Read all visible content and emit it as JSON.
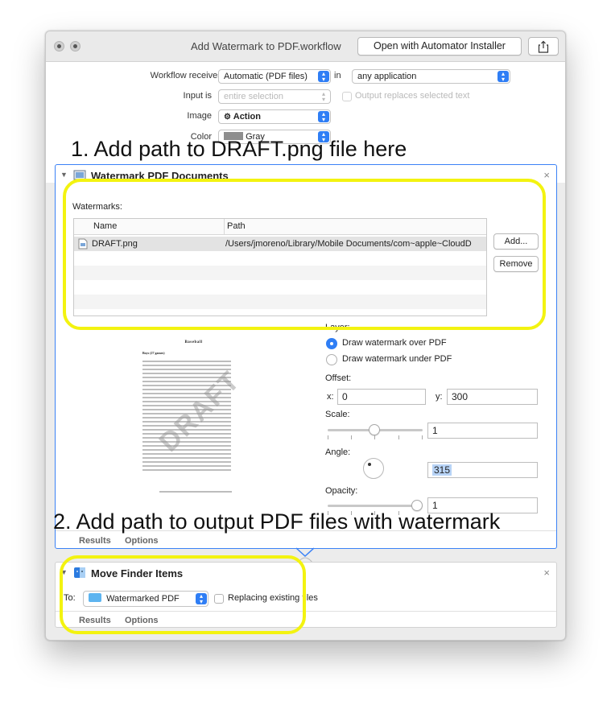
{
  "window": {
    "title": "Add Watermark to PDF.workflow",
    "open_button": "Open with Automator Installer",
    "share_icon": "share-icon"
  },
  "settings": {
    "receives_label": "Workflow receives current",
    "receives_value": "Automatic (PDF files)",
    "in_label": "in",
    "app_value": "any application",
    "input_is_label": "Input is",
    "input_is_value": "entire selection",
    "replaces_label": "Output replaces selected text",
    "image_label": "Image",
    "image_value": "Action",
    "color_label": "Color",
    "color_value": "Gray"
  },
  "annotations": {
    "step1": "1. Add path to DRAFT.png file here",
    "step2": "2. Add path to output PDF files with watermark"
  },
  "action1": {
    "title": "Watermark PDF Documents",
    "watermarks_label": "Watermarks:",
    "columns": [
      "Name",
      "Path"
    ],
    "rows": [
      {
        "name": "DRAFT.png",
        "path": "/Users/jmoreno/Library/Mobile Documents/com~apple~CloudD"
      }
    ],
    "add_button": "Add...",
    "remove_button": "Remove",
    "layer_label": "Layer:",
    "layer_over": "Draw watermark over PDF",
    "layer_under": "Draw watermark under PDF",
    "layer_selected": "over",
    "offset_label": "Offset:",
    "x_label": "x:",
    "x_value": "0",
    "y_label": "y:",
    "y_value": "300",
    "scale_label": "Scale:",
    "scale_value": "1",
    "angle_label": "Angle:",
    "angle_value": "315",
    "opacity_label": "Opacity:",
    "opacity_value": "1",
    "preview_title": "Baseball",
    "preview_subtitle": "Boys (27 games)",
    "preview_watermark": "DRAFT",
    "tabs": [
      "Results",
      "Options"
    ]
  },
  "action2": {
    "title": "Move Finder Items",
    "to_label": "To:",
    "to_value": "Watermarked PDF",
    "replacing_label": "Replacing existing files",
    "tabs": [
      "Results",
      "Options"
    ]
  },
  "colors": {
    "accent": "#2f7ef5",
    "highlight": "#f3f310",
    "selection_border": "#3b82f6"
  }
}
